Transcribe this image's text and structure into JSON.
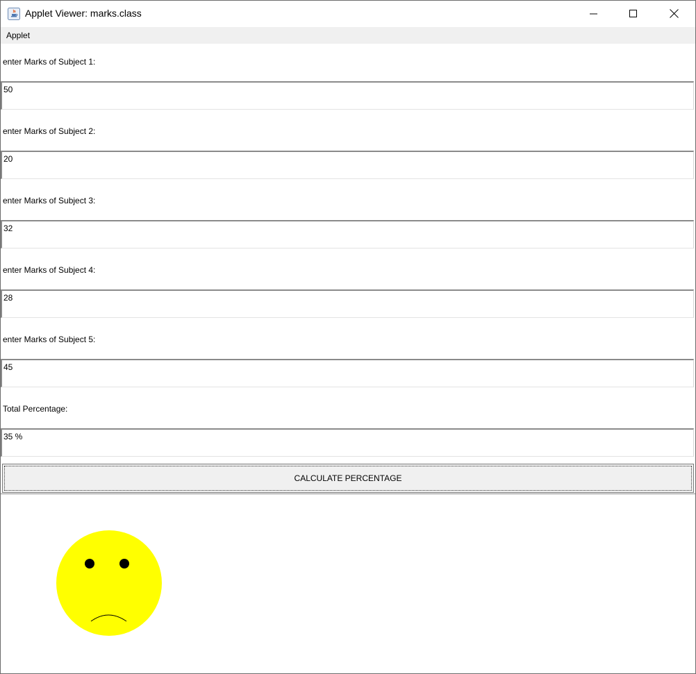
{
  "window": {
    "title": "Applet Viewer: marks.class",
    "app_icon": "java-icon",
    "controls": [
      "minimize-icon",
      "maximize-icon",
      "close-icon"
    ]
  },
  "menubar": {
    "items": [
      {
        "label": "Applet"
      }
    ]
  },
  "form": {
    "subjects": [
      {
        "label": "enter Marks of Subject 1:",
        "value": "50"
      },
      {
        "label": "enter Marks of Subject 2:",
        "value": "20"
      },
      {
        "label": "enter Marks of Subject 3:",
        "value": "32"
      },
      {
        "label": "enter Marks of Subject 4:",
        "value": "28"
      },
      {
        "label": "enter Marks of Subject 5:",
        "value": "45"
      }
    ],
    "total": {
      "label": "Total Percentage:",
      "value": "35 %"
    },
    "button_label": "CALCULATE PERCENTAGE"
  },
  "drawing": {
    "face": "sad-face",
    "face_color": "#ffff00",
    "feature_color": "#000000"
  }
}
